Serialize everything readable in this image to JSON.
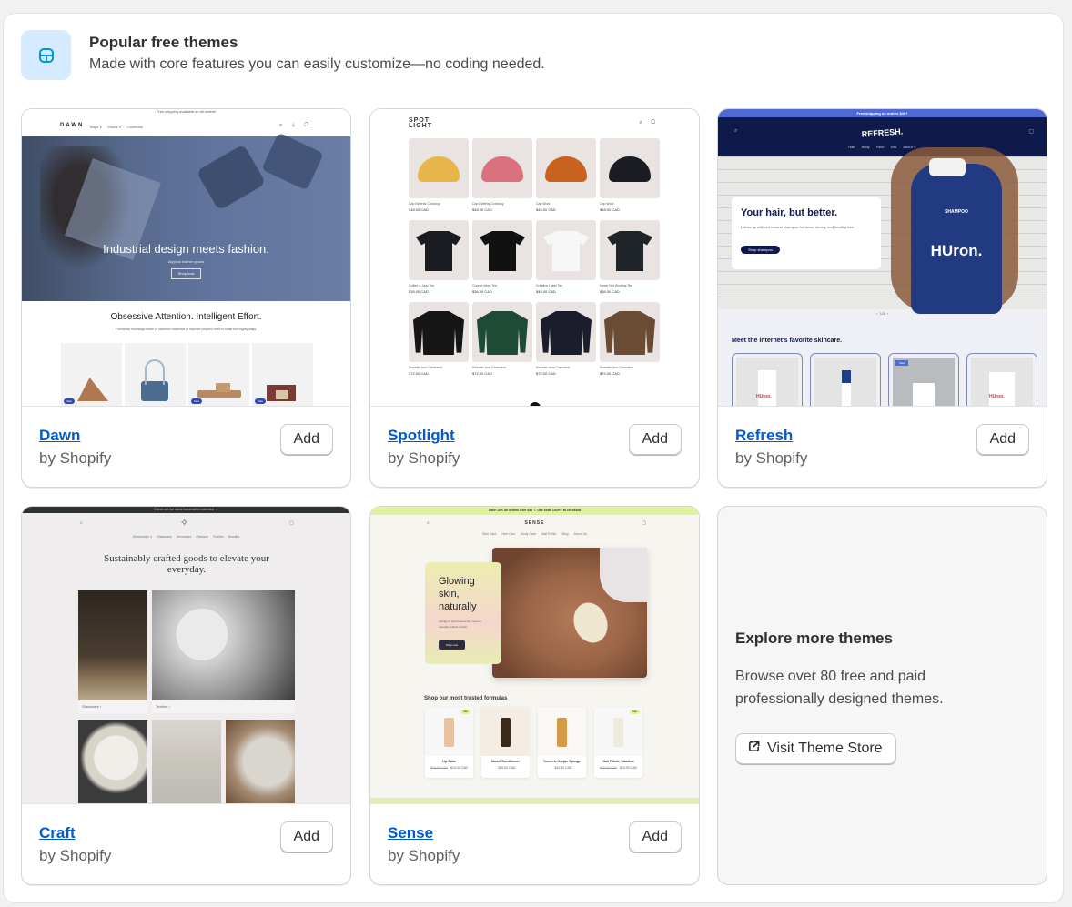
{
  "header": {
    "icon": "theme-layout-icon",
    "title": "Popular free themes",
    "subtitle": "Made with core features you can easily customize—no coding needed."
  },
  "themes": [
    {
      "name": "Dawn",
      "author": "by Shopify",
      "add_label": "Add",
      "preview": {
        "announcement": "Free shipping available on all orders!",
        "logo": "DAWN",
        "nav": [
          "Bags ∨",
          "Shoes ∨",
          "Lookbook"
        ],
        "hero_title": "Industrial design meets fashion.",
        "hero_sub": "Atypical leather goods",
        "hero_button": "Shop now",
        "section_title": "Obsessive Attention. Intelligent Effort.",
        "section_sub": "Functional handbags made of luxurious materials to improve people's lives in small but mighty ways.",
        "badge": "Sale"
      }
    },
    {
      "name": "Spotlight",
      "author": "by Shopify",
      "add_label": "Add",
      "preview": {
        "logo": "SPOT LIGHT",
        "products": [
          {
            "title": "Cap Elderbs Corduroy",
            "price": "$48.00 CAD",
            "color": "#e8b54a"
          },
          {
            "title": "Cap Elderbs Corduroy",
            "price": "$48.00 CAD",
            "color": "#d9727d"
          },
          {
            "title": "Cap Wool",
            "price": "$48.00 CAD",
            "color": "#c8621e"
          },
          {
            "title": "Cap Wool",
            "price": "$48.00 CAD",
            "color": "#1c1d24"
          },
          {
            "title": "Coffee & Jazz Tee",
            "price": "$36.00 CAD",
            "color": "#1a1c22"
          },
          {
            "title": "Course Work Tee",
            "price": "$36.00 CAD",
            "color": "#111111"
          },
          {
            "title": "Creative Label Tee",
            "price": "$48.00 CAD",
            "color": "#f7f7f7"
          },
          {
            "title": "Never Not Working Tee",
            "price": "$36.00 CAD",
            "color": "#1f2428"
          },
          {
            "title": "Sweater Icon Crewneck",
            "price": "$72.00 CAD",
            "color": "#161616"
          },
          {
            "title": "Sweater Icon Crewneck",
            "price": "$72.00 CAD",
            "color": "#1f4a35"
          },
          {
            "title": "Sweater Icon Crewneck",
            "price": "$72.00 CAD",
            "color": "#1c1d2c"
          },
          {
            "title": "Sweater Icon Crewneck",
            "price": "$72.00 CAD",
            "color": "#6a4b34"
          }
        ]
      }
    },
    {
      "name": "Refresh",
      "author": "by Shopify",
      "add_label": "Add",
      "preview": {
        "announcement": "Free shipping on orders $40+",
        "logo": "REFRESH.",
        "nav": [
          "Hair",
          "Body",
          "Face",
          "Kits",
          "About ∨"
        ],
        "hero_title": "Your hair, but better.",
        "hero_sub": "Lather up with our newest shampoo for clean, strong, and healthy hair.",
        "hero_button": "Shop shampoo",
        "bottle_label": "SHAMPOO",
        "bottle_brand": "HUron.",
        "pager": "1/3",
        "section_title": "Meet the internet's favorite skincare.",
        "badge": "Sale",
        "product_brand": "HUron."
      }
    },
    {
      "name": "Craft",
      "author": "by Shopify",
      "add_label": "Add",
      "preview": {
        "announcement": "Check out our latest handcrafted collection →",
        "nav": [
          "Dinnerware ∨",
          "Glassware",
          "Serveware",
          "Flatware",
          "Textiles",
          "Bundles"
        ],
        "hero_title": "Sustainably crafted goods to elevate your everyday.",
        "collections": [
          "Glassware ›",
          "Textiles ›"
        ]
      }
    },
    {
      "name": "Sense",
      "author": "by Shopify",
      "add_label": "Add",
      "preview": {
        "announcement": "Save 10% on orders over $50 ♡ Use code 10OFF at checkout",
        "logo": "SENSE",
        "nav": [
          "Skin Care",
          "Hair Care",
          "Body Care",
          "Nail Polish",
          "Blog",
          "About Us"
        ],
        "hero_title": "Glowing skin, naturally",
        "hero_sub": "Indulge in plant-based skin care for naturally radiant results.",
        "hero_button": "Shop now",
        "section_title": "Shop our most trusted formulas",
        "badge": "Sale",
        "products": [
          {
            "title": "Lip Balm",
            "old_price": "$18.00 CAD",
            "price": "$14.00 CAD"
          },
          {
            "title": "Monoi Conditioner",
            "old_price": "",
            "price": "$30.00 CAD"
          },
          {
            "title": "Turmeric Konjac Sponge",
            "old_price": "",
            "price": "$14.00 CAD"
          },
          {
            "title": "Nail Polish: Stardust",
            "old_price": "$20.00 CAD",
            "price": "$14.00 CAD"
          }
        ]
      }
    }
  ],
  "explore": {
    "title": "Explore more themes",
    "description": "Browse over 80 free and paid professionally designed themes.",
    "button_icon": "external-link-icon",
    "button_label": "Visit Theme Store"
  },
  "colors": {
    "link": "#005bd3",
    "header_icon_bg": "#d5ebff",
    "header_icon": "#0094d5",
    "refresh_navy": "#0f1a4c",
    "refresh_accent": "#4f6ad5",
    "sense_lime": "#dff29c"
  }
}
